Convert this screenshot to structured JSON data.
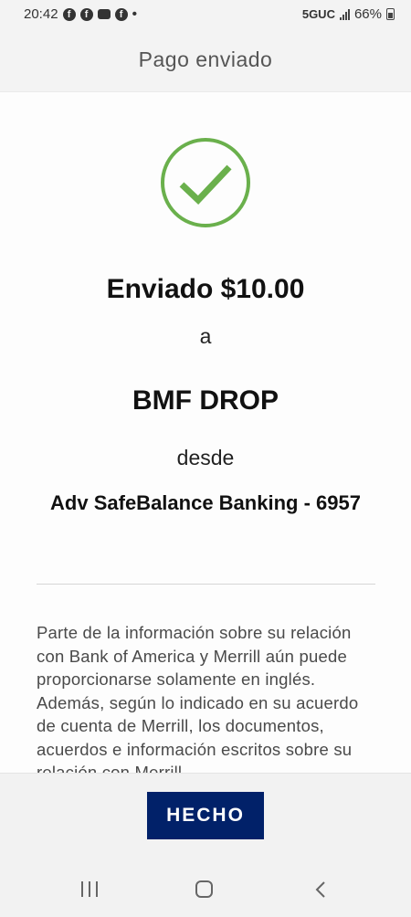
{
  "status_bar": {
    "time": "20:42",
    "notification_icons": [
      "facebook-icon",
      "facebook-icon",
      "message-icon",
      "facebook-icon"
    ],
    "more_dot": "•",
    "network": "5GUC",
    "battery": "66%"
  },
  "header": {
    "title": "Pago enviado"
  },
  "confirmation": {
    "sent_amount": "Enviado $10.00",
    "to_word": "a",
    "recipient": "BMF DROP",
    "from_word": "desde",
    "account": "Adv SafeBalance Banking - 6957",
    "check_color": "#6ab04c"
  },
  "disclaimer": {
    "text": "Parte de la información sobre su relación con Bank of America y Merrill aún puede proporcionarse solamente en inglés. Además, según lo indicado en su acuerdo de cuenta de Merrill, los documentos, acuerdos e información escritos sobre su relación con Merrill"
  },
  "footer": {
    "done_label": "HECHO",
    "done_color": "#012169"
  },
  "nav_bar": {
    "icons": [
      "recent-apps-icon",
      "home-icon",
      "back-icon"
    ]
  }
}
